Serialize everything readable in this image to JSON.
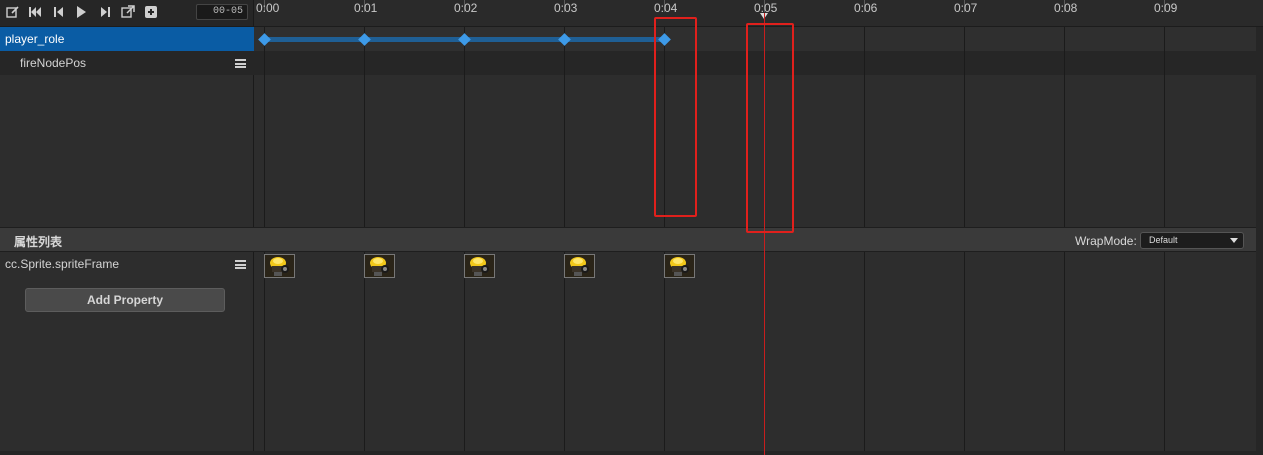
{
  "toolbar": {
    "icons": [
      "edit-icon",
      "skip-to-start-icon",
      "step-back-icon",
      "play-icon",
      "step-forward-icon",
      "external-link-icon",
      "add-frame-icon"
    ],
    "frame_value": "00-05"
  },
  "ruler": {
    "ticks": [
      "0:00",
      "0:01",
      "0:02",
      "0:03",
      "0:04",
      "0:05",
      "0:06",
      "0:07",
      "0:08",
      "0:09"
    ],
    "current_frame": 5
  },
  "nodes": [
    {
      "label": "player_role",
      "selected": true
    },
    {
      "label": "fireNodePos",
      "selected": false
    }
  ],
  "keyframes": {
    "player_role": [
      0,
      1,
      2,
      3,
      4
    ]
  },
  "properties": {
    "header": "属性列表",
    "wrap_mode_label": "WrapMode:",
    "wrap_mode_value": "Default",
    "items": [
      {
        "label": "cc.Sprite.spriteFrame",
        "keyframes": [
          0,
          1,
          2,
          3,
          4
        ]
      }
    ],
    "add_button": "Add Property"
  },
  "colors": {
    "selection": "#0a5ca4",
    "keyframe": "#3d9ae8",
    "playhead": "#c81e1e",
    "annotation": "#e0201c"
  }
}
